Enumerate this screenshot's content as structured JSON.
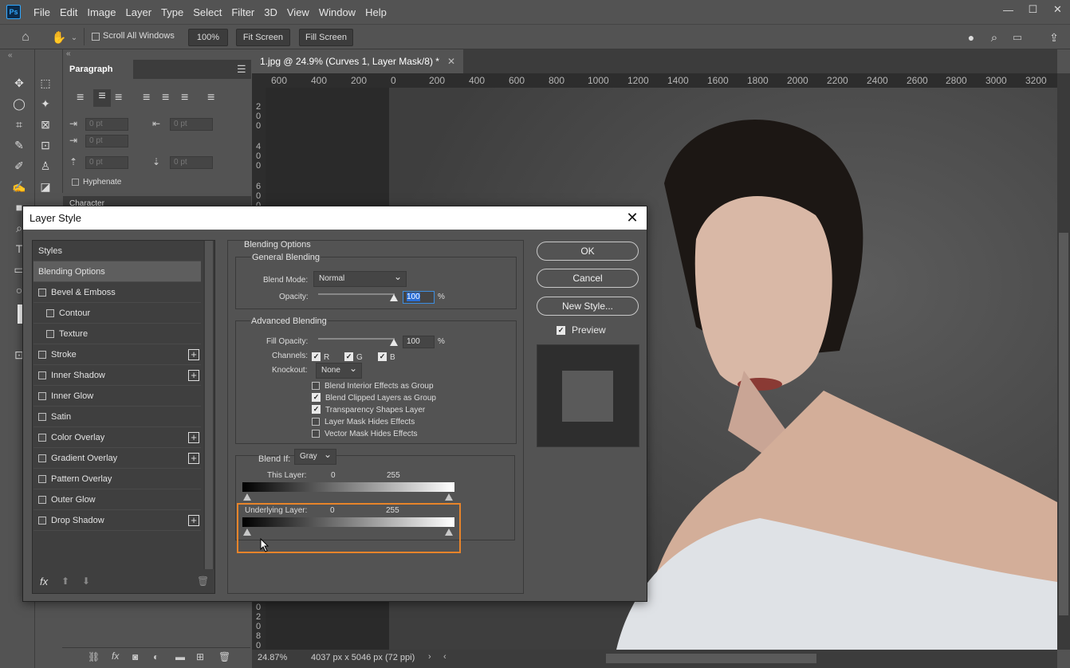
{
  "app": {
    "logo": "Ps"
  },
  "menu": [
    "File",
    "Edit",
    "Image",
    "Layer",
    "Type",
    "Select",
    "Filter",
    "3D",
    "View",
    "Window",
    "Help"
  ],
  "window_controls": {
    "minimize": "—",
    "restore": "☐",
    "close": "✕"
  },
  "options": {
    "scroll_all_windows": "Scroll All Windows",
    "zoom": "100%",
    "fit_screen": "Fit Screen",
    "fill_screen": "Fill Screen"
  },
  "paragraph_panel": {
    "title": "Paragraph",
    "field_values": [
      "0 pt",
      "0 pt",
      "0 pt",
      "0 pt",
      "0 pt"
    ],
    "hyphenate": "Hyphenate",
    "character_tab": "Character"
  },
  "document": {
    "tab_title": "1.jpg @ 24.9% (Curves 1, Layer Mask/8) *",
    "ruler_ticks": [
      "600",
      "400",
      "200",
      "0",
      "200",
      "400",
      "600",
      "800",
      "1000",
      "1200",
      "1400",
      "1600",
      "1800",
      "2000",
      "2200",
      "2400",
      "2600",
      "2800",
      "3000",
      "3200"
    ],
    "vruler_ticks": [
      "2",
      "0",
      "0",
      "4",
      "0",
      "0",
      "6",
      "0",
      "0"
    ],
    "vruler_bottom": [
      "0",
      "2",
      "0",
      "8",
      "0"
    ]
  },
  "status": {
    "zoom": "24.87%",
    "info": "4037 px x 5046 px (72 ppi)"
  },
  "dialog": {
    "title": "Layer Style",
    "close": "✕",
    "styles_header": "Styles",
    "style_items": [
      {
        "label": "Blending Options",
        "checkbox": false,
        "plus": false,
        "active": true
      },
      {
        "label": "Bevel & Emboss",
        "checkbox": true,
        "plus": false
      },
      {
        "label": "Contour",
        "checkbox": true,
        "plus": false,
        "indent": true
      },
      {
        "label": "Texture",
        "checkbox": true,
        "plus": false,
        "indent": true
      },
      {
        "label": "Stroke",
        "checkbox": true,
        "plus": true
      },
      {
        "label": "Inner Shadow",
        "checkbox": true,
        "plus": true
      },
      {
        "label": "Inner Glow",
        "checkbox": true,
        "plus": false
      },
      {
        "label": "Satin",
        "checkbox": true,
        "plus": false
      },
      {
        "label": "Color Overlay",
        "checkbox": true,
        "plus": true
      },
      {
        "label": "Gradient Overlay",
        "checkbox": true,
        "plus": true
      },
      {
        "label": "Pattern Overlay",
        "checkbox": true,
        "plus": false
      },
      {
        "label": "Outer Glow",
        "checkbox": true,
        "plus": false
      },
      {
        "label": "Drop Shadow",
        "checkbox": true,
        "plus": true
      }
    ],
    "fx": "fx",
    "blending_options": "Blending Options",
    "general_blending": "General Blending",
    "blend_mode_label": "Blend Mode:",
    "blend_mode": "Normal",
    "opacity_label": "Opacity:",
    "opacity": "100",
    "percent": "%",
    "advanced_blending": "Advanced Blending",
    "fill_opacity_label": "Fill Opacity:",
    "fill_opacity": "100",
    "channels_label": "Channels:",
    "channels": [
      "R",
      "G",
      "B"
    ],
    "knockout_label": "Knockout:",
    "knockout": "None",
    "checks": [
      {
        "label": "Blend Interior Effects as Group",
        "checked": false
      },
      {
        "label": "Blend Clipped Layers as Group",
        "checked": true
      },
      {
        "label": "Transparency Shapes Layer",
        "checked": true
      },
      {
        "label": "Layer Mask Hides Effects",
        "checked": false
      },
      {
        "label": "Vector Mask Hides Effects",
        "checked": false
      }
    ],
    "blend_if_label": "Blend If:",
    "blend_if": "Gray",
    "this_layer_label": "This Layer:",
    "this_layer_min": "0",
    "this_layer_max": "255",
    "underlying_label": "Underlying Layer:",
    "underlying_min": "0",
    "underlying_max": "255",
    "ok": "OK",
    "cancel": "Cancel",
    "new_style": "New Style...",
    "preview": "Preview",
    "highlight_color": "#e8842a"
  }
}
